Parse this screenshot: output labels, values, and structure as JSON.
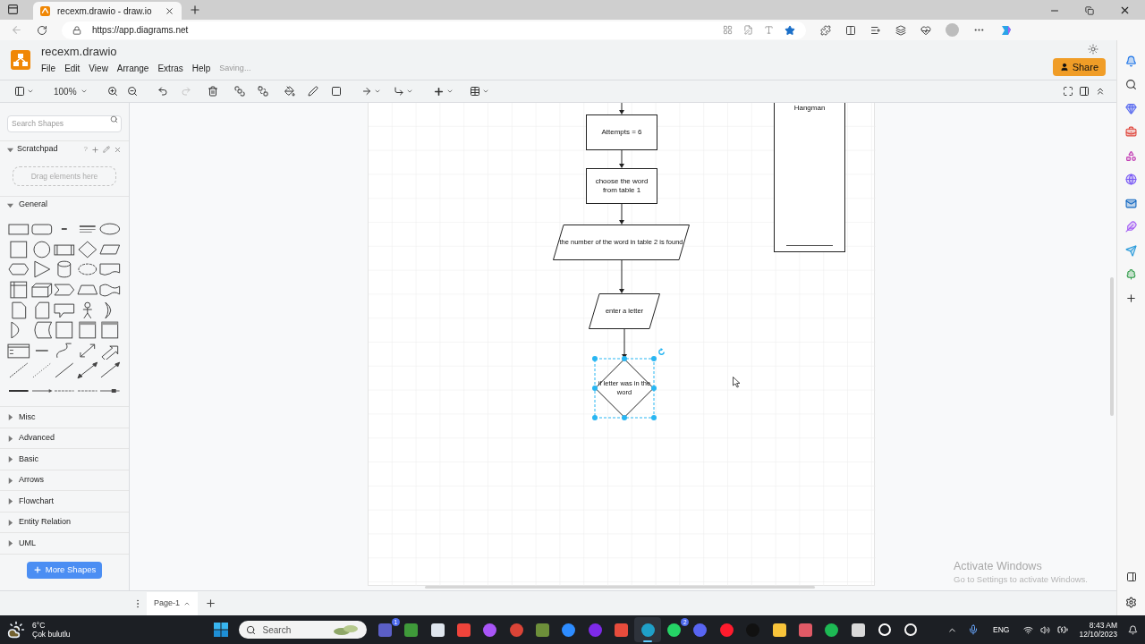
{
  "browser": {
    "tabs": [
      {
        "title": "recexm.drawio - draw.io",
        "selected": true
      }
    ],
    "url": "https://app.diagrams.net",
    "favorite": true
  },
  "app": {
    "filename": "recexm.drawio",
    "menu": [
      "File",
      "Edit",
      "View",
      "Arrange",
      "Extras",
      "Help"
    ],
    "status": "Saving...",
    "share": "Share"
  },
  "toolbar": {
    "zoom": "100%",
    "history": [
      {
        "kind": "undo",
        "disabled": false
      },
      {
        "kind": "redo",
        "disabled": true
      }
    ]
  },
  "sidebar": {
    "search_placeholder": "Search Shapes",
    "scratchpad": {
      "title": "Scratchpad",
      "help": "?",
      "hint": "Drag elements here",
      "expanded": true
    },
    "sections": [
      {
        "title": "General",
        "expanded": true
      },
      {
        "title": "Misc",
        "expanded": false
      },
      {
        "title": "Advanced",
        "expanded": false
      },
      {
        "title": "Basic",
        "expanded": false
      },
      {
        "title": "Arrows",
        "expanded": false
      },
      {
        "title": "Flowchart",
        "expanded": false
      },
      {
        "title": "Entity Relation",
        "expanded": false
      },
      {
        "title": "UML",
        "expanded": false
      }
    ],
    "more_shapes": "More Shapes"
  },
  "diagram": {
    "nodes": [
      {
        "kind": "process",
        "text": "Attempts = 6",
        "selected": false
      },
      {
        "kind": "process",
        "text": "choose the word from table 1",
        "selected": false
      },
      {
        "kind": "io",
        "text": "the number of the word in table 2 is found",
        "selected": false
      },
      {
        "kind": "io",
        "text": "enter a letter",
        "selected": false
      },
      {
        "kind": "decision",
        "text": "if letter was in the word",
        "selected": true
      }
    ],
    "container": {
      "title": "Hangman"
    }
  },
  "pages": [
    {
      "label": "Page-1",
      "selected": true
    }
  ],
  "activation_notice": {
    "title": "Activate Windows",
    "text": "Go to Settings to activate Windows."
  },
  "taskbar": {
    "weather": {
      "temperature": "6°C",
      "condition": "Çok bulutlu"
    },
    "search_placeholder": "Search",
    "apps": [
      {
        "kind": "square",
        "color": "#5b5fc7",
        "badge": "1",
        "selected": false
      },
      {
        "kind": "square",
        "color": "#3f9a3a",
        "selected": false
      },
      {
        "kind": "square",
        "color": "#dfe6ee",
        "selected": false
      },
      {
        "kind": "square",
        "color": "#ef443b",
        "selected": false
      },
      {
        "kind": "circle",
        "color": "#a855f7",
        "selected": false
      },
      {
        "kind": "circle",
        "color": "#db4437",
        "selected": false
      },
      {
        "kind": "square",
        "color": "#6d8f3a",
        "selected": false
      },
      {
        "kind": "circle",
        "color": "#2d8cff",
        "selected": false
      },
      {
        "kind": "circle",
        "color": "#7d2ae8",
        "selected": false
      },
      {
        "kind": "square",
        "color": "#e74c3c",
        "selected": false
      },
      {
        "kind": "circle",
        "color": "#1fa0c8",
        "selected": true
      },
      {
        "kind": "circle",
        "color": "#25d366",
        "badge": "2",
        "selected": false
      },
      {
        "kind": "circle",
        "color": "#5865f2",
        "selected": false
      },
      {
        "kind": "circle",
        "color": "#ff1b2d",
        "selected": false
      },
      {
        "kind": "circle",
        "color": "#111111",
        "selected": false
      },
      {
        "kind": "square",
        "color": "#f8c43a",
        "selected": false
      },
      {
        "kind": "square",
        "color": "#e05a66",
        "selected": false
      },
      {
        "kind": "circle",
        "color": "#1db954",
        "selected": false
      },
      {
        "kind": "square",
        "color": "#d9d9d9",
        "selected": false
      },
      {
        "kind": "ring",
        "color": "#ffffff",
        "selected": false
      },
      {
        "kind": "ring",
        "color": "#f2f2f2",
        "selected": false
      }
    ],
    "language": "ENG",
    "time": "8:43 AM",
    "date": "12/10/2023"
  }
}
